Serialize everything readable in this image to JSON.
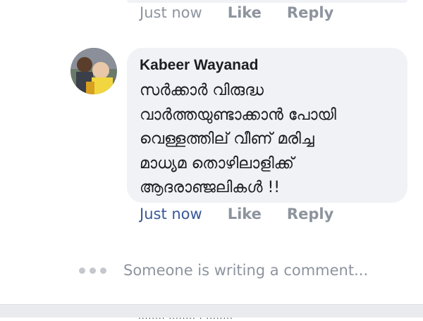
{
  "previous_comment": {
    "time": "Just now",
    "like_label": "Like",
    "reply_label": "Reply"
  },
  "comment": {
    "author": "Kabeer Wayanad",
    "lines": [
      "സർക്കാർ വിരുദ്ധ",
      "വാർത്തയുണ്ടാക്കാൻ പോയി",
      "വെള്ളത്തില് വീണ് മരിച്ച",
      "മാധ്യമ തൊഴിലാളിക്ക്",
      "ആദരാഞ്ജലികൾ !!"
    ],
    "time": "Just now",
    "like_label": "Like",
    "reply_label": "Reply"
  },
  "typing_indicator": {
    "text": "Someone is writing a comment..."
  },
  "bottom_cutoff": {
    "text": "........ ........ . ........"
  },
  "colors": {
    "bubble": "#f0f2f5",
    "link_blue": "#385898",
    "muted": "#8d949e"
  },
  "icons": [
    "avatar-photo",
    "typing-dots-icon"
  ]
}
